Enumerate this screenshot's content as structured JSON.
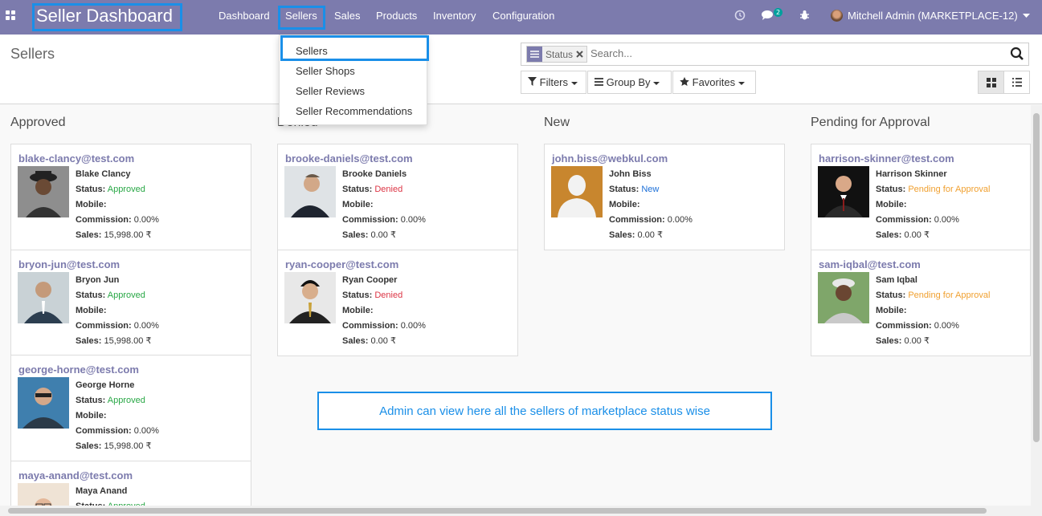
{
  "navbar": {
    "brand": "Seller Dashboard",
    "menus": [
      "Dashboard",
      "Sellers",
      "Sales",
      "Products",
      "Inventory",
      "Configuration"
    ],
    "messages_count": "2",
    "user": "Mitchell Admin (MARKETPLACE-12)",
    "icons": [
      "apps-icon",
      "clock-icon",
      "chat-icon",
      "bug-icon",
      "caret-down-icon"
    ]
  },
  "dropdown": {
    "items": [
      "Sellers",
      "Seller Shops",
      "Seller Reviews",
      "Seller Recommendations"
    ]
  },
  "control": {
    "breadcrumb": "Sellers",
    "facet_label": "Status",
    "search_placeholder": "Search...",
    "filters": "Filters",
    "group_by": "Group By",
    "favorites": "Favorites"
  },
  "labels": {
    "status": "Status:",
    "mobile": "Mobile:",
    "commission": "Commission:",
    "sales": "Sales:"
  },
  "columns": [
    {
      "title": "Approved",
      "cards": [
        {
          "email": "blake-clancy@test.com",
          "name": "Blake Clancy",
          "status": "Approved",
          "mobile": "",
          "commission": "0.00%",
          "sales": "15,998.00 ₹"
        },
        {
          "email": "bryon-jun@test.com",
          "name": "Bryon Jun",
          "status": "Approved",
          "mobile": "",
          "commission": "0.00%",
          "sales": "15,998.00 ₹"
        },
        {
          "email": "george-horne@test.com",
          "name": "George Horne",
          "status": "Approved",
          "mobile": "",
          "commission": "0.00%",
          "sales": "15,998.00 ₹"
        },
        {
          "email": "maya-anand@test.com",
          "name": "Maya Anand",
          "status": "Approved",
          "mobile": "",
          "commission": "",
          "sales": ""
        }
      ]
    },
    {
      "title": "Denied",
      "cards": [
        {
          "email": "brooke-daniels@test.com",
          "name": "Brooke Daniels",
          "status": "Denied",
          "mobile": "",
          "commission": "0.00%",
          "sales": "0.00 ₹"
        },
        {
          "email": "ryan-cooper@test.com",
          "name": "Ryan Cooper",
          "status": "Denied",
          "mobile": "",
          "commission": "0.00%",
          "sales": "0.00 ₹"
        }
      ]
    },
    {
      "title": "New",
      "cards": [
        {
          "email": "john.biss@webkul.com",
          "name": "John Biss",
          "status": "New",
          "mobile": "",
          "commission": "0.00%",
          "sales": "0.00 ₹"
        }
      ]
    },
    {
      "title": "Pending for Approval",
      "cards": [
        {
          "email": "harrison-skinner@test.com",
          "name": "Harrison Skinner",
          "status": "Pending for Approval",
          "mobile": "",
          "commission": "0.00%",
          "sales": "0.00 ₹"
        },
        {
          "email": "sam-iqbal@test.com",
          "name": "Sam Iqbal",
          "status": "Pending for Approval",
          "mobile": "",
          "commission": "0.00%",
          "sales": "0.00 ₹"
        }
      ]
    }
  ],
  "callout": "Admin can view here all the sellers of marketplace status wise",
  "colors": {
    "navbar": "#7c7bad",
    "highlight": "#1a8fe8",
    "approved": "#28a745",
    "denied": "#dc3545",
    "new": "#1b6fd8",
    "pending": "#f0a030"
  }
}
